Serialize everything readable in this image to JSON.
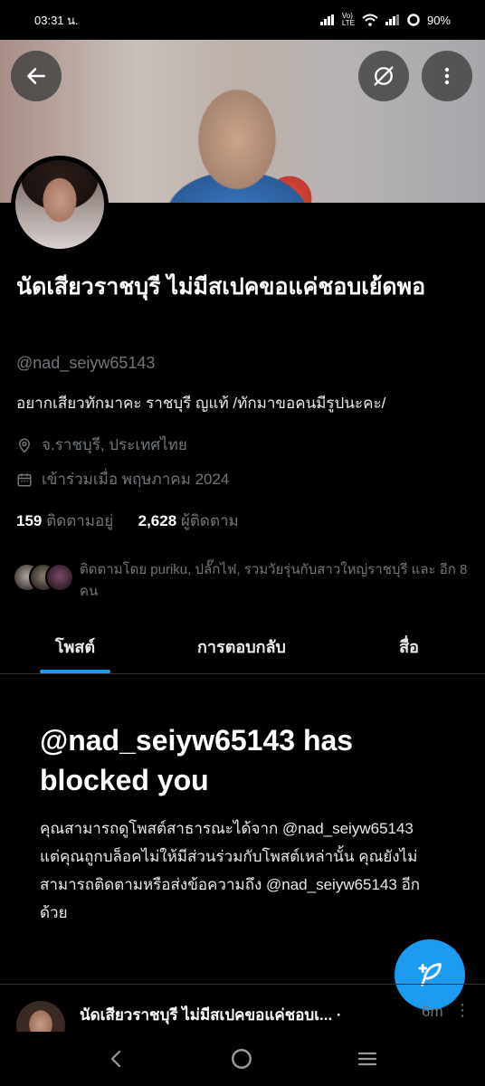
{
  "status": {
    "time": "03:31 น.",
    "battery": "90%"
  },
  "profile": {
    "name": "นัดเสียวราชบุรี ไม่มีสเปคขอแค่ชอบเย้ดพอ",
    "handle": "@nad_seiyw65143",
    "bio": "อยากเสียวทักมาคะ ราชบุรี ญแท้ /ทักมาขอคนมีรูปนะคะ/",
    "location": "จ.ราชบุรี, ประเทศไทย",
    "joined": "เข้าร่วมเมื่อ พฤษภาคม 2024",
    "following_count": "159",
    "following_label": "ติดตามอยู่",
    "followers_count": "2,628",
    "followers_label": "ผู้ติดตาม",
    "followed_by": "ติดตามโดย puriku, ปลั๊กไฟ, รวมวัยรุ่นกับสาวใหญ่ราชบุรี และ อีก 8 คน"
  },
  "tabs": [
    {
      "label": "โพสต์"
    },
    {
      "label": "การตอบกลับ"
    },
    {
      "label": "สื่อ"
    }
  ],
  "blocked": {
    "title": "@nad_seiyw65143 has blocked you",
    "body": "คุณสามารถดูโพสต์สาธารณะได้จาก @nad_seiyw65143 แต่คุณถูกบล็อคไม่ให้มีส่วนร่วมกับโพสต์เหล่านั้น คุณยังไม่สามารถติดตามหรือส่งข้อความถึง @nad_seiyw65143 อีกด้วย"
  },
  "post": {
    "name": "นัดเสียวราชบุรี ไม่มีสเปคขอแค่ชอบเ... ·",
    "time": "6m"
  },
  "colors": {
    "accent": "#1d9bf0",
    "background": "#000000",
    "muted": "#71767b"
  }
}
